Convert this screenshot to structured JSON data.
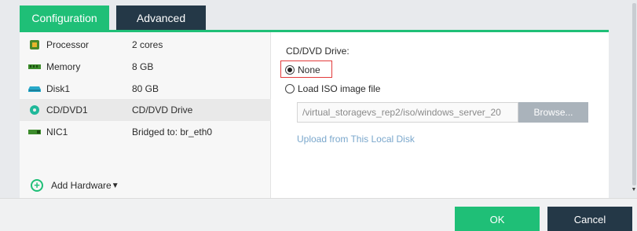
{
  "tabs": [
    {
      "label": "Configuration",
      "active": true
    },
    {
      "label": "Advanced",
      "active": false
    }
  ],
  "hardware": [
    {
      "name": "Processor",
      "value": "2 cores",
      "icon": "processor-icon"
    },
    {
      "name": "Memory",
      "value": "8 GB",
      "icon": "memory-icon"
    },
    {
      "name": "Disk1",
      "value": "80 GB",
      "icon": "disk-icon"
    },
    {
      "name": "CD/DVD1",
      "value": "CD/DVD Drive",
      "icon": "cd-dvd-icon",
      "selected": true
    },
    {
      "name": "NIC1",
      "value": "Bridged to: br_eth0",
      "icon": "nic-icon"
    }
  ],
  "add_hardware": {
    "label": "Add Hardware",
    "arrow": "▼"
  },
  "cd_dvd": {
    "title": "CD/DVD Drive:",
    "option_none": "None",
    "option_iso": "Load ISO image file",
    "iso_path": "/virtual_storagevs_rep2/iso/windows_server_20",
    "browse_label": "Browse...",
    "upload_link": "Upload from This Local Disk",
    "selected_option": "None"
  },
  "footer": {
    "ok_label": "OK",
    "cancel_label": "Cancel"
  },
  "colors": {
    "accent": "#1fbf77",
    "dark": "#243847",
    "highlight": "#e23b3b"
  }
}
